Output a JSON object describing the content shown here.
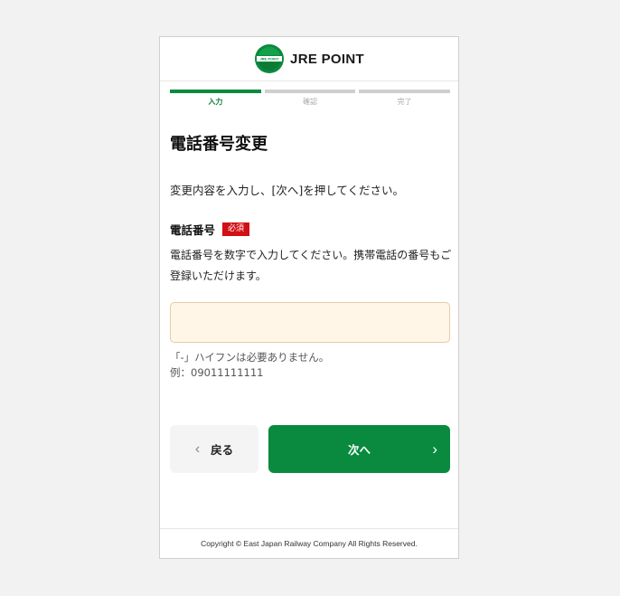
{
  "header": {
    "logo_text": "JRE POINT",
    "logo_mark_text": "JRE POINT",
    "brand_color": "#0a8a3e"
  },
  "steps": [
    {
      "label": "入力",
      "active": true
    },
    {
      "label": "確認",
      "active": false
    },
    {
      "label": "完了",
      "active": false
    }
  ],
  "page": {
    "title": "電話番号変更",
    "lead": "変更内容を入力し、[次へ]を押してください。"
  },
  "form": {
    "field_label": "電話番号",
    "required_badge": "必須",
    "help_text": "電話番号を数字で入力してください。携帯電話の番号もご登録いただけます。",
    "phone_value": "",
    "note_line1": "「-」ハイフンは必要ありません。",
    "note_line2": "例：09011111111"
  },
  "buttons": {
    "back_label": "戻る",
    "next_label": "次へ",
    "back_icon": "chevron-left-icon",
    "next_icon": "chevron-right-icon"
  },
  "footer": {
    "copyright": "Copyright © East Japan Railway Company All Rights Reserved."
  },
  "colors": {
    "accent": "#0a8a3e",
    "required": "#d10f14",
    "input_bg": "#fff6e8",
    "page_bg": "#f2f2f2"
  }
}
